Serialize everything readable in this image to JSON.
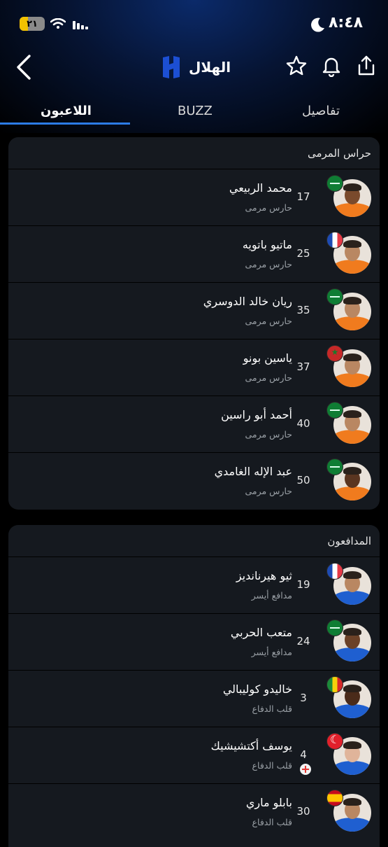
{
  "status_bar": {
    "time": "٨:٤٨",
    "battery_level": "٢١"
  },
  "header": {
    "title": "الهلال",
    "icons": [
      "chevron-left-icon",
      "club-logo",
      "star-icon",
      "bell-icon",
      "share-icon"
    ]
  },
  "tabs": [
    {
      "label": "تفاصيل",
      "active": false
    },
    {
      "label": "BUZZ",
      "active": false
    },
    {
      "label": "اللاعبون",
      "active": true
    }
  ],
  "colors": {
    "accent": "#2c7be5",
    "card_bg": "#15191f",
    "secondary_text": "#9aa0a6",
    "gk_kit": "#f07b1e",
    "def_kit": "#1f5fd0"
  },
  "sections": [
    {
      "title": "حراس المرمى",
      "players": [
        {
          "name": "محمد الربيعي",
          "position": "حارس مرمى",
          "number": "17",
          "flag": "saudi-arabia-flag"
        },
        {
          "name": "ماتيو باتويه",
          "position": "حارس مرمى",
          "number": "25",
          "flag": "france-flag"
        },
        {
          "name": "ريان خالد الدوسري",
          "position": "حارس مرمى",
          "number": "35",
          "flag": "saudi-arabia-flag"
        },
        {
          "name": "ياسين بونو",
          "position": "حارس مرمى",
          "number": "37",
          "flag": "morocco-flag"
        },
        {
          "name": "أحمد أبو راسين",
          "position": "حارس مرمى",
          "number": "40",
          "flag": "saudi-arabia-flag"
        },
        {
          "name": "عبد الإله الغامدي",
          "position": "حارس مرمى",
          "number": "50",
          "flag": "saudi-arabia-flag"
        }
      ]
    },
    {
      "title": "المدافعون",
      "players": [
        {
          "name": "ثيو هيرنانديز",
          "position": "مدافع أيسر",
          "number": "19",
          "flag": "france-flag"
        },
        {
          "name": "متعب الحربي",
          "position": "مدافع أيسر",
          "number": "24",
          "flag": "saudi-arabia-flag"
        },
        {
          "name": "خاليدو كوليبالي",
          "position": "قلب الدفاع",
          "number": "3",
          "flag": "senegal-flag"
        },
        {
          "name": "يوسف أكتشيشيك",
          "position": "قلب الدفاع",
          "number": "4",
          "flag": "turkey-flag",
          "injured": true
        },
        {
          "name": "بابلو ماري",
          "position": "قلب الدفاع",
          "number": "30",
          "flag": "spain-flag"
        }
      ]
    }
  ]
}
